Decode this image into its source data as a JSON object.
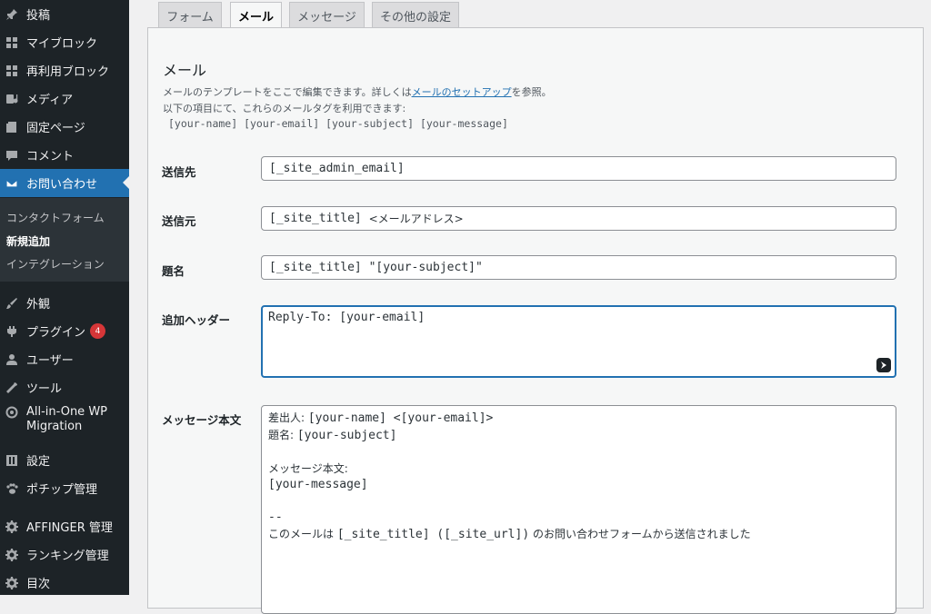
{
  "sidebar": {
    "items": [
      {
        "label": "投稿",
        "icon": "pin-icon"
      },
      {
        "label": "マイブロック",
        "icon": "blocks-icon"
      },
      {
        "label": "再利用ブロック",
        "icon": "blocks-icon"
      },
      {
        "label": "メディア",
        "icon": "media-icon"
      },
      {
        "label": "固定ページ",
        "icon": "page-icon"
      },
      {
        "label": "コメント",
        "icon": "comment-icon"
      },
      {
        "label": "お問い合わせ",
        "icon": "mail-icon"
      },
      {
        "label": "外観",
        "icon": "brush-icon"
      },
      {
        "label": "プラグイン",
        "icon": "plugin-icon",
        "badge": "4"
      },
      {
        "label": "ユーザー",
        "icon": "user-icon"
      },
      {
        "label": "ツール",
        "icon": "wrench-icon"
      },
      {
        "label": "All-in-One WP",
        "label2": "Migration",
        "icon": "aio-icon"
      },
      {
        "label": "設定",
        "icon": "settings-icon"
      },
      {
        "label": "ポチップ管理",
        "icon": "paw-icon"
      },
      {
        "label": "AFFINGER 管理",
        "icon": "gear-icon"
      },
      {
        "label": "ランキング管理",
        "icon": "gear-icon"
      },
      {
        "label": "目次",
        "icon": "gear-icon"
      }
    ],
    "submenu": [
      "コンタクトフォーム",
      "新規追加",
      "インテグレーション"
    ]
  },
  "tabs": [
    "フォーム",
    "メール",
    "メッセージ",
    "その他の設定"
  ],
  "mail": {
    "title": "メール",
    "desc_before": "メールのテンプレートをここで編集できます。詳しくは",
    "desc_link": "メールのセットアップ",
    "desc_after": "を参照。",
    "desc2": "以下の項目にて、これらのメールタグを利用できます:",
    "tags": "[your-name] [your-email] [your-subject] [your-message]"
  },
  "fields": {
    "to_label": "送信先",
    "to_value": "[_site_admin_email]",
    "from_label": "送信元",
    "from_value_code": "[_site_title] ",
    "from_value_jp": "<メールアドレス>",
    "subject_label": "題名",
    "subject_value": "[_site_title] \"[your-subject]\"",
    "headers_label": "追加ヘッダー",
    "headers_value": "Reply-To: [your-email]",
    "body_label": "メッセージ本文",
    "body_line1_jp": "差出人: ",
    "body_line1_code": "[your-name] <[your-email]>",
    "body_line2_jp": "題名: ",
    "body_line2_code": "[your-subject]",
    "body_line4": "メッセージ本文:",
    "body_line5": "[your-message]",
    "body_line7": "--",
    "body_line8_a": "このメールは ",
    "body_line8_b": "[_site_title] ([_site_url])",
    "body_line8_c": " のお問い合わせフォームから送信されました"
  }
}
